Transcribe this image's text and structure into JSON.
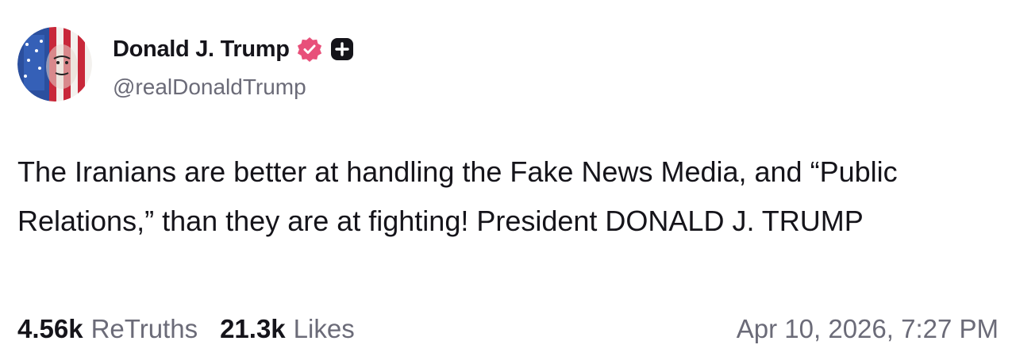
{
  "author": {
    "display_name": "Donald J. Trump",
    "handle": "@realDonaldTrump",
    "verified_icon": "verified-badge-icon",
    "verified_color": "#e8507a",
    "subscription_icon": "plus-badge-icon"
  },
  "post": {
    "text": "The Iranians are better at handling the Fake News Media, and “Public Relations,” than they are at fighting! President DONALD J. TRUMP",
    "retruths_count": "4.56k",
    "retruths_label": "ReTruths",
    "likes_count": "21.3k",
    "likes_label": "Likes",
    "timestamp": "Apr 10, 2026, 7:27 PM"
  },
  "colors": {
    "text_primary": "#15141a",
    "text_secondary": "#6b6b78",
    "background": "#ffffff"
  }
}
